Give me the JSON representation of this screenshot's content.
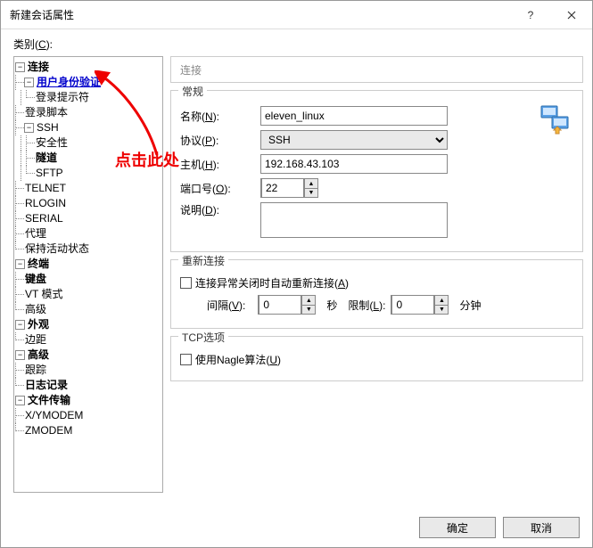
{
  "window": {
    "title": "新建会话属性"
  },
  "category_label": "类别",
  "tree": {
    "connection": "连接",
    "user_auth": "用户身份验证",
    "login_prompt": "登录提示符",
    "login_script": "登录脚本",
    "ssh": "SSH",
    "security": "安全性",
    "tunnel": "隧道",
    "sftp": "SFTP",
    "telnet": "TELNET",
    "rlogin": "RLOGIN",
    "serial": "SERIAL",
    "proxy": "代理",
    "keepalive": "保持活动状态",
    "terminal": "终端",
    "keyboard": "键盘",
    "vt_mode": "VT 模式",
    "advanced_term": "高级",
    "appearance": "外观",
    "margin": "边距",
    "advanced": "高级",
    "trace": "跟踪",
    "logging": "日志记录",
    "file_transfer": "文件传输",
    "xymodem": "X/YMODEM",
    "zmodem": "ZMODEM"
  },
  "panel": {
    "header": "连接",
    "general_legend": "常规",
    "name_label": "名称",
    "name_accel": "N",
    "name_value": "eleven_linux",
    "protocol_label": "协议",
    "protocol_accel": "P",
    "protocol_value": "SSH",
    "host_label": "主机",
    "host_accel": "H",
    "host_value": "192.168.43.103",
    "port_label": "端口号",
    "port_accel": "O",
    "port_value": "22",
    "desc_label": "说明",
    "desc_accel": "D",
    "desc_value": "",
    "reconnect_legend": "重新连接",
    "reconnect_checkbox": "连接异常关闭时自动重新连接",
    "reconnect_accel": "A",
    "interval_label": "间隔",
    "interval_accel": "V",
    "interval_value": "0",
    "seconds_label": "秒",
    "limit_label": "限制",
    "limit_accel": "L",
    "limit_value": "0",
    "minutes_label": "分钟",
    "tcp_legend": "TCP选项",
    "nagle_label": "使用Nagle算法",
    "nagle_accel": "U"
  },
  "buttons": {
    "ok": "确定",
    "cancel": "取消"
  },
  "annotation": "点击此处"
}
